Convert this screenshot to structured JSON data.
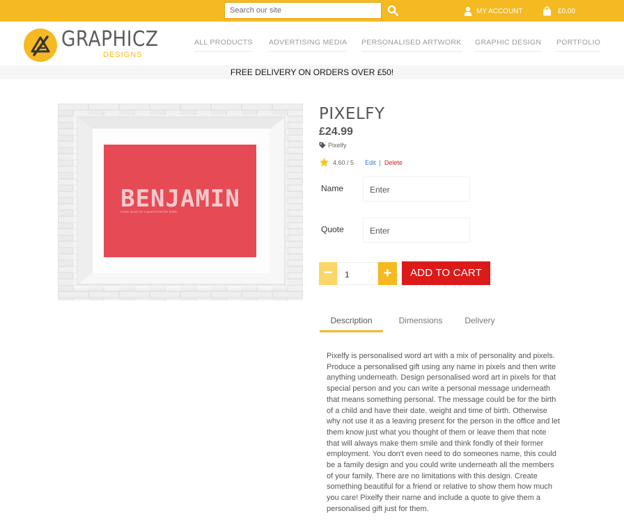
{
  "topbar": {
    "search_placeholder": "Search our site",
    "icons": {
      "search": "search-icon",
      "account": "user-icon",
      "cart": "bag-icon"
    },
    "account_label": "MY ACCOUNT",
    "cart_total": "£0.00"
  },
  "header": {
    "logo_text": "GRAPHICZ",
    "logo_sub": "DESIGNS",
    "nav": [
      "ALL PRODUCTS",
      "ADVERTISING MEDIA",
      "PERSONALISED ARTWORK",
      "GRAPHIC DESIGN",
      "PORTFOLIO"
    ]
  },
  "banner": {
    "text": "FREE DELIVERY ON ORDERS OVER £50!"
  },
  "product": {
    "image_name": "BENJAMIN",
    "image_subtext": "Lorem ipsum for a good friend the better",
    "title": "PIXELFY",
    "price": "£24.99",
    "tag": "Pixelfy",
    "rating": "4.60 / 5",
    "edit_label": "Edit",
    "separator": "|",
    "delete_label": "Delete",
    "fields": [
      {
        "label": "Name",
        "value": "Enter"
      },
      {
        "label": "Quote",
        "value": "Enter"
      }
    ],
    "qty_minus": "−",
    "quantity": "1",
    "qty_plus": "+",
    "add_to_cart": "ADD TO CART"
  },
  "tabs": [
    "Description",
    "Dimensions",
    "Delivery"
  ],
  "description": "Pixelfy is personalised word art with a mix of personality and pixels. Produce a personalised gift using any name in pixels and then write anything underneath. Design personalised word art in pixels for that special person and you can write a personal message underneath that means something personal. The message could be for the birth of a child and have their date, weight and time of birth. Otherwise why not use it as a leaving present for the person in the office and let them know just what you thought of them or leave them that note that will always make them smile and think fondly of their former employment. You don't even need to do someones name, this could be a family design and you could write underneath all the members of your family. There are no limitations with this design. Create something beautiful for a friend or relative to show them how much you care! Pixelfy their name and include a quote to give them a personalised gift just for them.",
  "colors": {
    "brand_yellow": "#f5b921",
    "cart_red": "#db1a1a",
    "frame_mat": "#e64a55"
  }
}
